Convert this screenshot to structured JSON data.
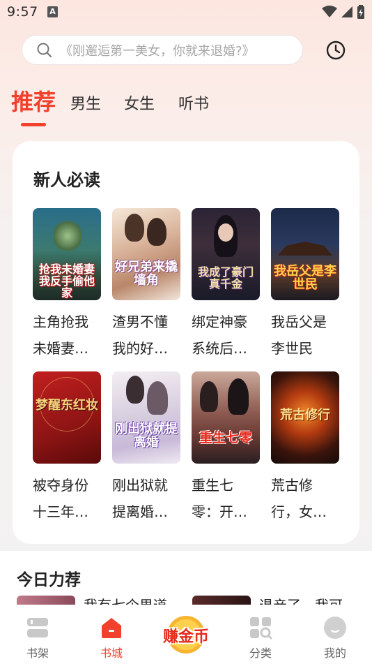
{
  "status_bar": {
    "time": "9:57",
    "notification_letter": "A"
  },
  "search": {
    "placeholder": "《刚邂逅第一美女，你就来退婚?》"
  },
  "tabs": [
    {
      "label": "推荐",
      "active": true
    },
    {
      "label": "男生",
      "active": false
    },
    {
      "label": "女生",
      "active": false
    },
    {
      "label": "听书",
      "active": false
    }
  ],
  "new_reader": {
    "title": "新人必读",
    "books": [
      {
        "line1": "主角抢我",
        "line2": "未婚妻…",
        "cover_text": "抢我未婚妻我反手偷他家"
      },
      {
        "line1": "渣男不懂",
        "line2": "我的好…",
        "cover_text": "好兄弟来撬墙角"
      },
      {
        "line1": "绑定神豪",
        "line2": "系统后…",
        "cover_text": "我成了豪门真千金"
      },
      {
        "line1": "我岳父是",
        "line2": "李世民",
        "cover_text": "我岳父是李世民"
      },
      {
        "line1": "被夺身份",
        "line2": "十三年…",
        "cover_text": "梦醒东红妆"
      },
      {
        "line1": "刚出狱就",
        "line2": "提离婚…",
        "cover_text": "刚出狱就提离婚"
      },
      {
        "line1": "重生七",
        "line2": "零：开…",
        "cover_text": "重生七零"
      },
      {
        "line1": "荒古修",
        "line2": "行，女…",
        "cover_text": "荒古修行"
      }
    ]
  },
  "today": {
    "title": "今日力荐",
    "items": [
      {
        "text": "我有七个男道"
      },
      {
        "text": "退亲了，我可"
      }
    ]
  },
  "bottom_nav": {
    "items": [
      {
        "label": "书架",
        "icon": "bookshelf-icon",
        "active": false
      },
      {
        "label": "书城",
        "icon": "bookstore-icon",
        "active": true
      },
      {
        "label": "分类",
        "icon": "category-icon",
        "active": false
      },
      {
        "label": "我的",
        "icon": "profile-icon",
        "active": false
      }
    ],
    "earn_label": "赚金币"
  },
  "colors": {
    "accent": "#f1402c",
    "gold": "#ffd24a"
  }
}
